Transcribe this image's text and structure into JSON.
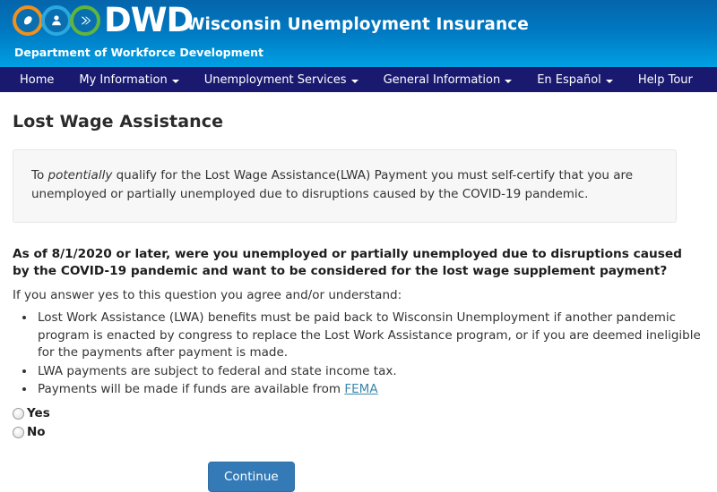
{
  "header": {
    "logo_word": "DWD",
    "logo_icons": [
      "hand-icon",
      "person-icon",
      "chevrons-icon"
    ],
    "title": "Wisconsin Unemployment Insurance",
    "subtitle": "Department of Workforce Development",
    "gradient_top": "#0565ab",
    "gradient_bottom": "#00a0e3"
  },
  "nav": {
    "background": "#191970",
    "items": [
      {
        "label": "Home",
        "has_caret": false
      },
      {
        "label": "My Information",
        "has_caret": true
      },
      {
        "label": "Unemployment Services",
        "has_caret": true
      },
      {
        "label": "General Information",
        "has_caret": true
      },
      {
        "label": "En Español",
        "has_caret": true
      },
      {
        "label": "Help Tour",
        "has_caret": false
      }
    ]
  },
  "page": {
    "title": "Lost Wage Assistance",
    "info_box": {
      "text_before_italic": "To ",
      "italic_word": "potentially",
      "text_after_italic": " qualify for the Lost Wage Assistance(LWA) Payment you must self-certify that you are unemployed or partially unemployed due to disruptions caused by the COVID-19 pandemic.",
      "background": "#f7f7f7"
    },
    "question": "As of 8/1/2020 or later, were you unemployed or partially unemployed due to disruptions caused by the COVID-19 pandemic and want to be considered for the lost wage supplement payment?",
    "agree_line": "If you answer yes to this question you agree and/or understand:",
    "terms": [
      "Lost Work Assistance (LWA) benefits must be paid back to Wisconsin Unemployment if another pandemic program is enacted by congress to replace the Lost Work Assistance program, or if you are deemed ineligible for the payments after payment is made.",
      "LWA payments are subject to federal and state income tax."
    ],
    "term_with_link": {
      "text_before": "Payments will be made if funds are available from ",
      "link_text": "FEMA",
      "link_color": "#3a87ad"
    },
    "radio_options": [
      {
        "label": "Yes",
        "selected": false
      },
      {
        "label": "No",
        "selected": false
      }
    ],
    "continue_label": "Continue",
    "continue_color": "#337ab7"
  }
}
